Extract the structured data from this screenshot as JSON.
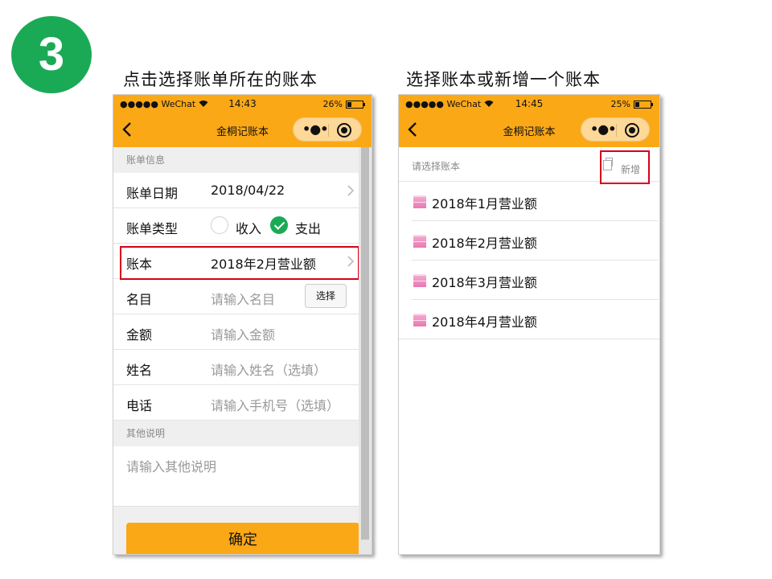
{
  "step": {
    "number": "3"
  },
  "captions": {
    "left": "点击选择账单所在的账本",
    "right": "选择账本或新增一个账本"
  },
  "left_phone": {
    "status": {
      "carrier": "●●●●● WeChat",
      "time": "14:43",
      "battery": "26%",
      "battery_level": 0.26
    },
    "nav": {
      "title": "金桐记账本"
    },
    "sections": {
      "bill_info": "账单信息",
      "other": "其他说明"
    },
    "rows": {
      "date": {
        "label": "账单日期",
        "value": "2018/04/22"
      },
      "type": {
        "label": "账单类型",
        "income": "收入",
        "expense": "支出",
        "selected": "expense"
      },
      "book": {
        "label": "账本",
        "value": "2018年2月营业额"
      },
      "item": {
        "label": "名目",
        "placeholder": "请输入名目",
        "button": "选择"
      },
      "amount": {
        "label": "金额",
        "placeholder": "请输入金额"
      },
      "name": {
        "label": "姓名",
        "placeholder": "请输入姓名（选填）"
      },
      "phone": {
        "label": "电话",
        "placeholder": "请输入手机号（选填）"
      }
    },
    "notes_placeholder": "请输入其他说明",
    "confirm": "确定"
  },
  "right_phone": {
    "status": {
      "carrier": "●●●●● WeChat",
      "time": "14:45",
      "battery": "25%",
      "battery_level": 0.25
    },
    "nav": {
      "title": "金桐记账本"
    },
    "list_hint": "请选择账本",
    "add_label": "新增",
    "books": [
      "2018年1月营业额",
      "2018年2月营业额",
      "2018年3月营业额",
      "2018年4月营业额"
    ]
  },
  "colors": {
    "accent": "#fba817",
    "success": "#1aaa55",
    "highlight": "#d9001b",
    "book_icon": "#e878b2"
  },
  "icons": {
    "back": "chevron-left-icon",
    "more": "more-dots-icon",
    "close": "target-circle-icon",
    "row_arrow": "chevron-right-icon",
    "add": "copy-icon",
    "book": "notebook-icon"
  }
}
